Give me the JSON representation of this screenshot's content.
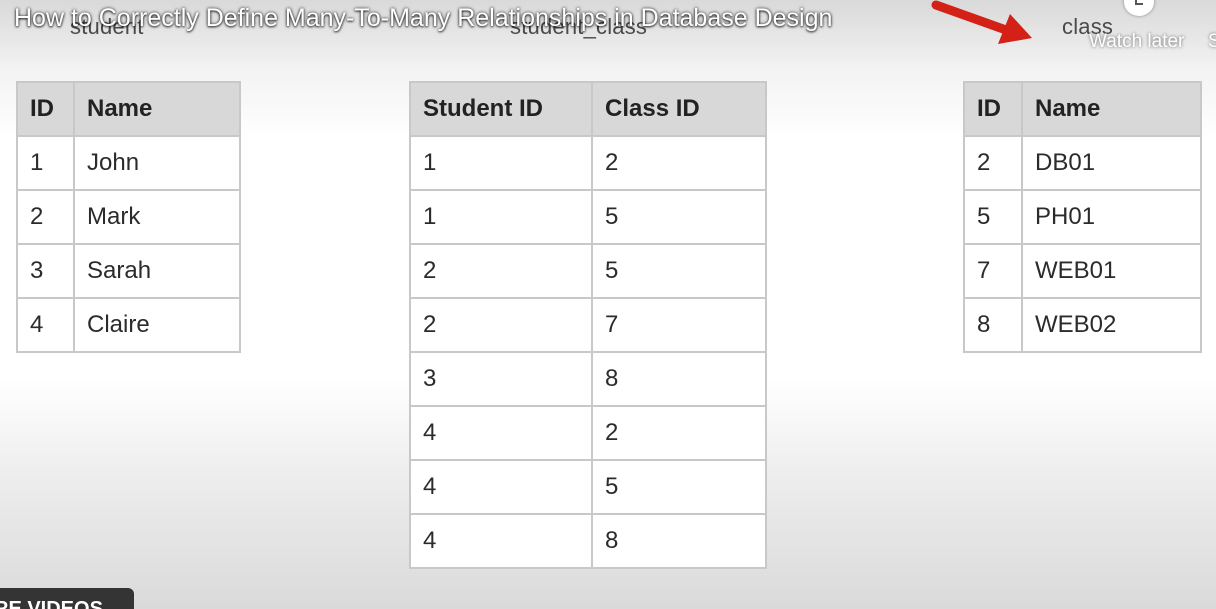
{
  "video": {
    "title": "How to Correctly Define Many-To-Many Relationships in Database Design",
    "watch_later": "Watch later",
    "share_partial": "S",
    "more_videos": "RE VIDEOS"
  },
  "tables": {
    "student": {
      "caption": "student",
      "headers": [
        "ID",
        "Name"
      ],
      "rows": [
        [
          "1",
          "John"
        ],
        [
          "2",
          "Mark"
        ],
        [
          "3",
          "Sarah"
        ],
        [
          "4",
          "Claire"
        ]
      ]
    },
    "student_class": {
      "caption": "student_class",
      "headers": [
        "Student ID",
        "Class ID"
      ],
      "rows": [
        [
          "1",
          "2"
        ],
        [
          "1",
          "5"
        ],
        [
          "2",
          "5"
        ],
        [
          "2",
          "7"
        ],
        [
          "3",
          "8"
        ],
        [
          "4",
          "2"
        ],
        [
          "4",
          "5"
        ],
        [
          "4",
          "8"
        ]
      ]
    },
    "class": {
      "caption": "class",
      "headers": [
        "ID",
        "Name"
      ],
      "rows": [
        [
          "2",
          "DB01"
        ],
        [
          "5",
          "PH01"
        ],
        [
          "7",
          "WEB01"
        ],
        [
          "8",
          "WEB02"
        ]
      ]
    }
  },
  "colors": {
    "header_bg": "#d8d8d8",
    "border": "#c8c8c8",
    "arrow": "#d32117"
  },
  "icons": {
    "arrow": "red-arrow-icon",
    "watch_later": "clock-icon"
  }
}
